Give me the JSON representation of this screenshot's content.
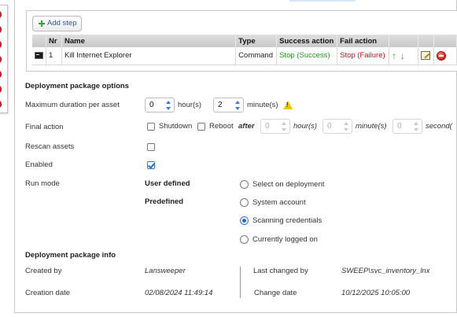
{
  "steps": {
    "add_step_label": "Add step",
    "columns": [
      "Nr",
      "Name",
      "Type",
      "Success action",
      "Fail action"
    ],
    "rows": [
      {
        "nr": "1",
        "name": "Kill Internet Explorer",
        "type": "Command",
        "success_action": "Stop (Success)",
        "fail_action": "Stop (Failure)"
      }
    ]
  },
  "options": {
    "title": "Deployment package options",
    "max_duration_label": "Maximum duration per asset",
    "hours_value": "0",
    "hours_unit": "hour(s)",
    "minutes_value": "2",
    "minutes_unit": "minute(s)",
    "final_action_label": "Final action",
    "shutdown_label": "Shutdown",
    "reboot_label": "Reboot",
    "after_label": "after",
    "after_hours_value": "0",
    "after_hours_unit": "hour(s)",
    "after_minutes_value": "0",
    "after_minutes_unit": "minute(s)",
    "after_seconds_value": "0",
    "after_seconds_unit": "second(",
    "rescan_label": "Rescan assets",
    "enabled_label": "Enabled",
    "run_mode_label": "Run mode",
    "user_defined_label": "User defined",
    "predefined_label": "Predefined",
    "run_modes": [
      "Select on deployment",
      "System account",
      "Scanning credentials",
      "Currently logged on"
    ]
  },
  "info": {
    "title": "Deployment package info",
    "created_by_label": "Created by",
    "created_by_value": "Lansweeper",
    "creation_date_label": "Creation date",
    "creation_date_value": "02/08/2024 11:49:14",
    "last_changed_by_label": "Last changed by",
    "last_changed_by_value": "SWEEP\\svc_inventory_lnx",
    "change_date_label": "Change date",
    "change_date_value": "10/12/2025 10:05:00"
  },
  "colors": {
    "success": "#1f9a1f",
    "failure": "#cc1111",
    "link": "#2a5a96",
    "accent": "#1e6fd0"
  }
}
